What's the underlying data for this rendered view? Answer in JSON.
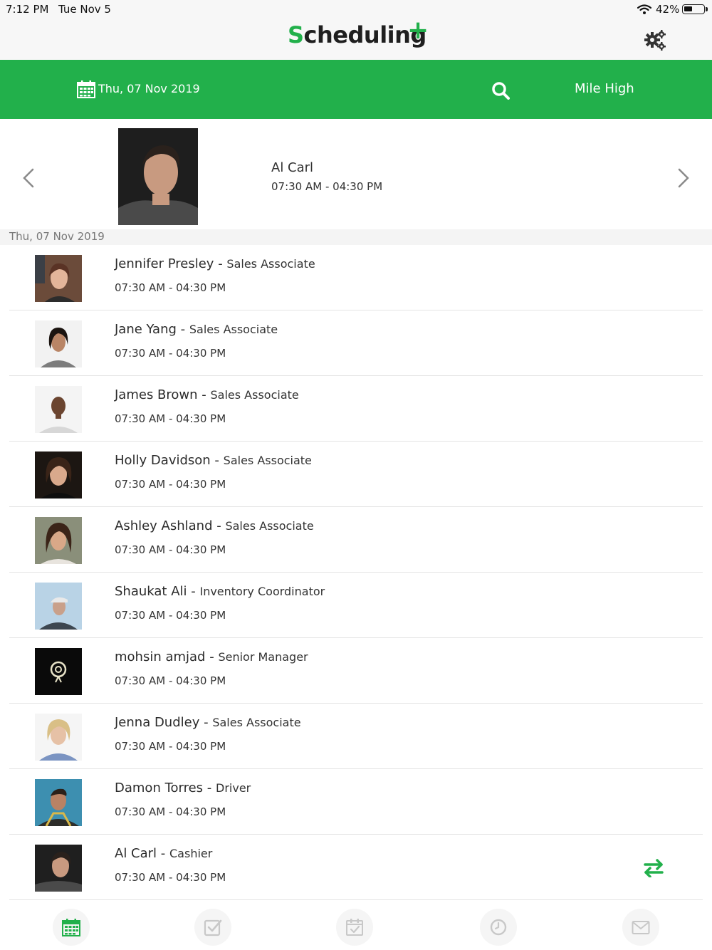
{
  "status_bar": {
    "time": "7:12 PM",
    "date": "Tue Nov 5",
    "battery": "42%",
    "battery_level": 0.42
  },
  "app": {
    "logo_text": "Scheduling",
    "logo_plus": "+"
  },
  "toolbar": {
    "date_label": "Thu, 07 Nov 2019",
    "location": "Mile High"
  },
  "featured": {
    "name": "Al Carl",
    "time": "07:30 AM - 04:30 PM"
  },
  "list_date_header": "Thu, 07 Nov 2019",
  "employees": [
    {
      "name": "Jennifer Presley",
      "role": "Sales Associate",
      "time": "07:30 AM - 04:30 PM"
    },
    {
      "name": "Jane Yang",
      "role": "Sales Associate",
      "time": "07:30 AM - 04:30 PM"
    },
    {
      "name": "James Brown",
      "role": "Sales Associate",
      "time": "07:30 AM - 04:30 PM"
    },
    {
      "name": "Holly Davidson",
      "role": "Sales Associate",
      "time": "07:30 AM - 04:30 PM"
    },
    {
      "name": "Ashley Ashland",
      "role": "Sales Associate",
      "time": "07:30 AM - 04:30 PM"
    },
    {
      "name": "Shaukat Ali",
      "role": "Inventory Coordinator",
      "time": "07:30 AM - 04:30 PM"
    },
    {
      "name": "mohsin amjad",
      "role": "Senior Manager",
      "time": "07:30 AM - 04:30 PM"
    },
    {
      "name": "Jenna Dudley",
      "role": "Sales Associate",
      "time": "07:30 AM - 04:30 PM"
    },
    {
      "name": "Damon  Torres",
      "role": "Driver",
      "time": "07:30 AM - 04:30 PM"
    },
    {
      "name": "Al Carl",
      "role": "Cashier",
      "time": "07:30 AM - 04:30 PM"
    }
  ],
  "separator": " - ",
  "icons": {
    "settings": "gears-icon",
    "calendar": "calendar-icon",
    "search": "search-icon",
    "prev": "chevron-left-icon",
    "next": "chevron-right-icon",
    "swap": "swap-arrows-icon",
    "tabs": [
      "calendar-icon",
      "check-square-icon",
      "calendar-check-icon",
      "clock-icon",
      "mail-icon"
    ]
  },
  "colors": {
    "accent": "#22b04b",
    "active_tab": "#22b04b",
    "inactive_tab": "#c8c8c8"
  }
}
